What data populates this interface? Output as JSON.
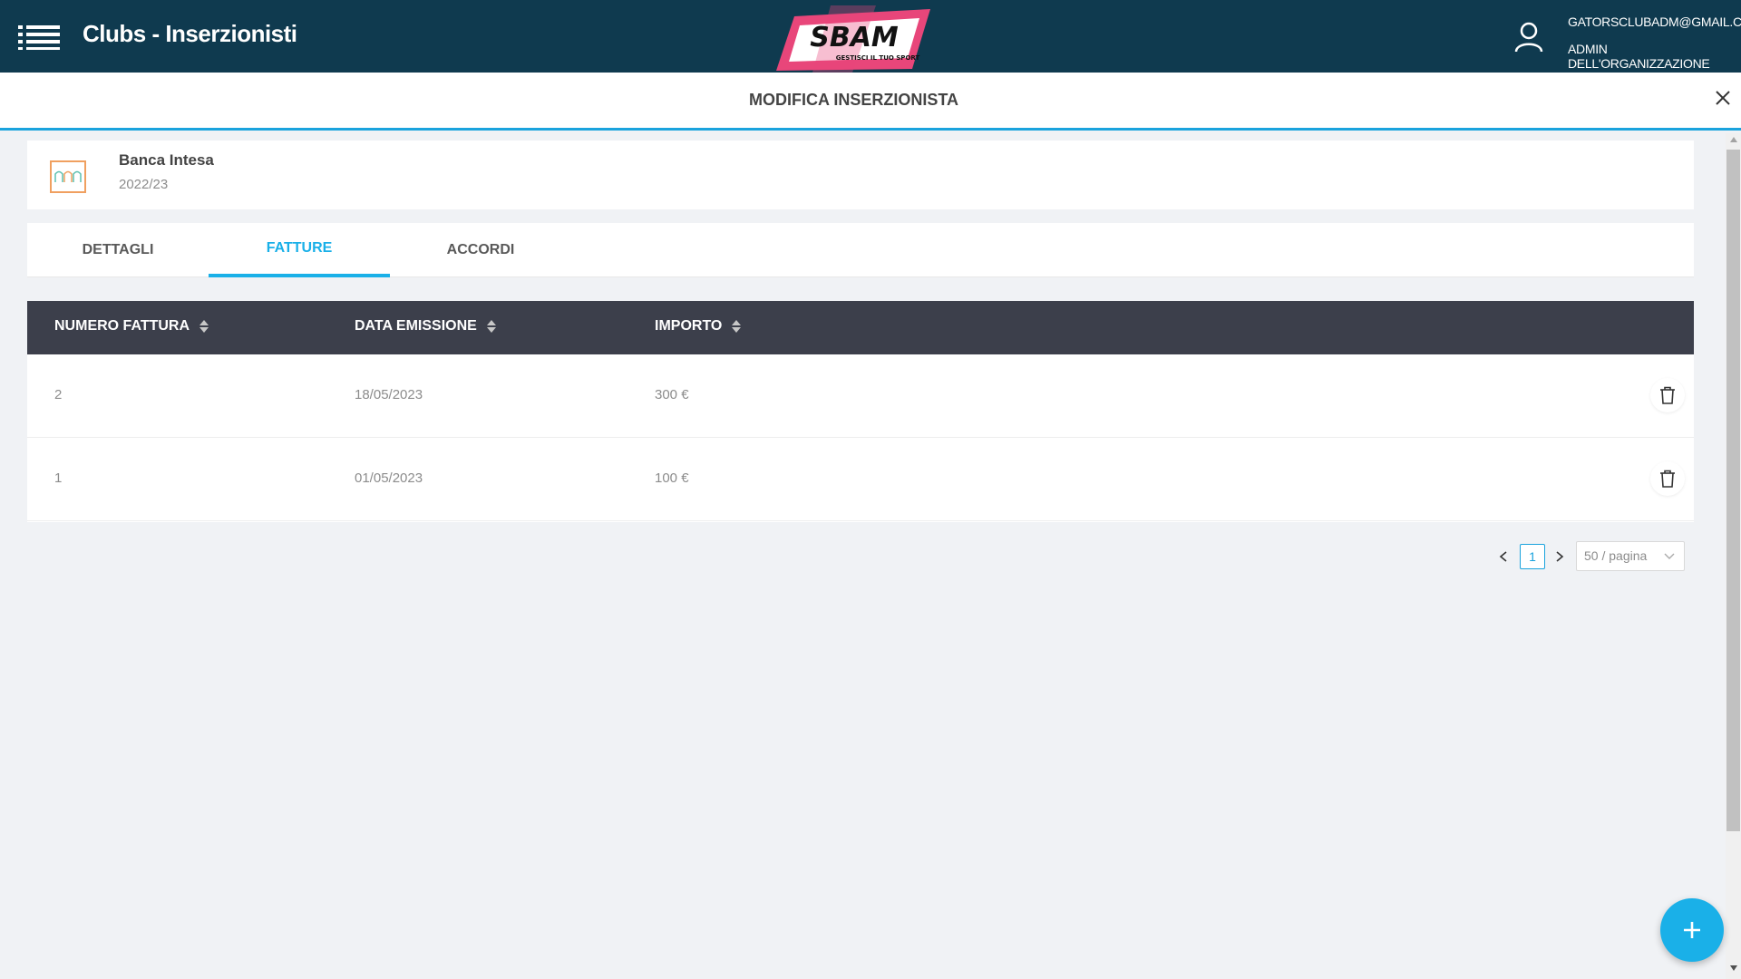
{
  "header": {
    "title": "Clubs - Inserzionisti",
    "logo_text": "SBAM",
    "logo_tagline": "GESTISCI IL TUO SPORT",
    "user_email": "GATORSCLUBADM@GMAIL.COM",
    "user_role": "ADMIN DELL'ORGANIZZAZIONE"
  },
  "drawer": {
    "title": "MODIFICA INSERZIONISTA"
  },
  "advertiser": {
    "name": "Banca Intesa",
    "season": "2022/23"
  },
  "tabs": [
    {
      "label": "DETTAGLI",
      "active": false
    },
    {
      "label": "FATTURE",
      "active": true
    },
    {
      "label": "ACCORDI",
      "active": false
    }
  ],
  "table": {
    "columns": [
      "NUMERO FATTURA",
      "DATA EMISSIONE",
      "IMPORTO"
    ],
    "rows": [
      {
        "numero": "2",
        "data": "18/05/2023",
        "importo": "300 €"
      },
      {
        "numero": "1",
        "data": "01/05/2023",
        "importo": "100 €"
      }
    ]
  },
  "pagination": {
    "current_page": "1",
    "page_size": "50 / pagina"
  },
  "colors": {
    "topbar": "#0f3a4f",
    "accent": "#1ab0e8",
    "table_header": "#3c3f4b",
    "logo_pink": "#e8467a"
  },
  "icons": {
    "menu": "menu-list-icon",
    "user": "user-icon",
    "close": "close-icon",
    "advertiser": "advertiser-logo-icon",
    "sort": "sort-icon",
    "delete": "trash-icon",
    "add": "plus-icon"
  }
}
